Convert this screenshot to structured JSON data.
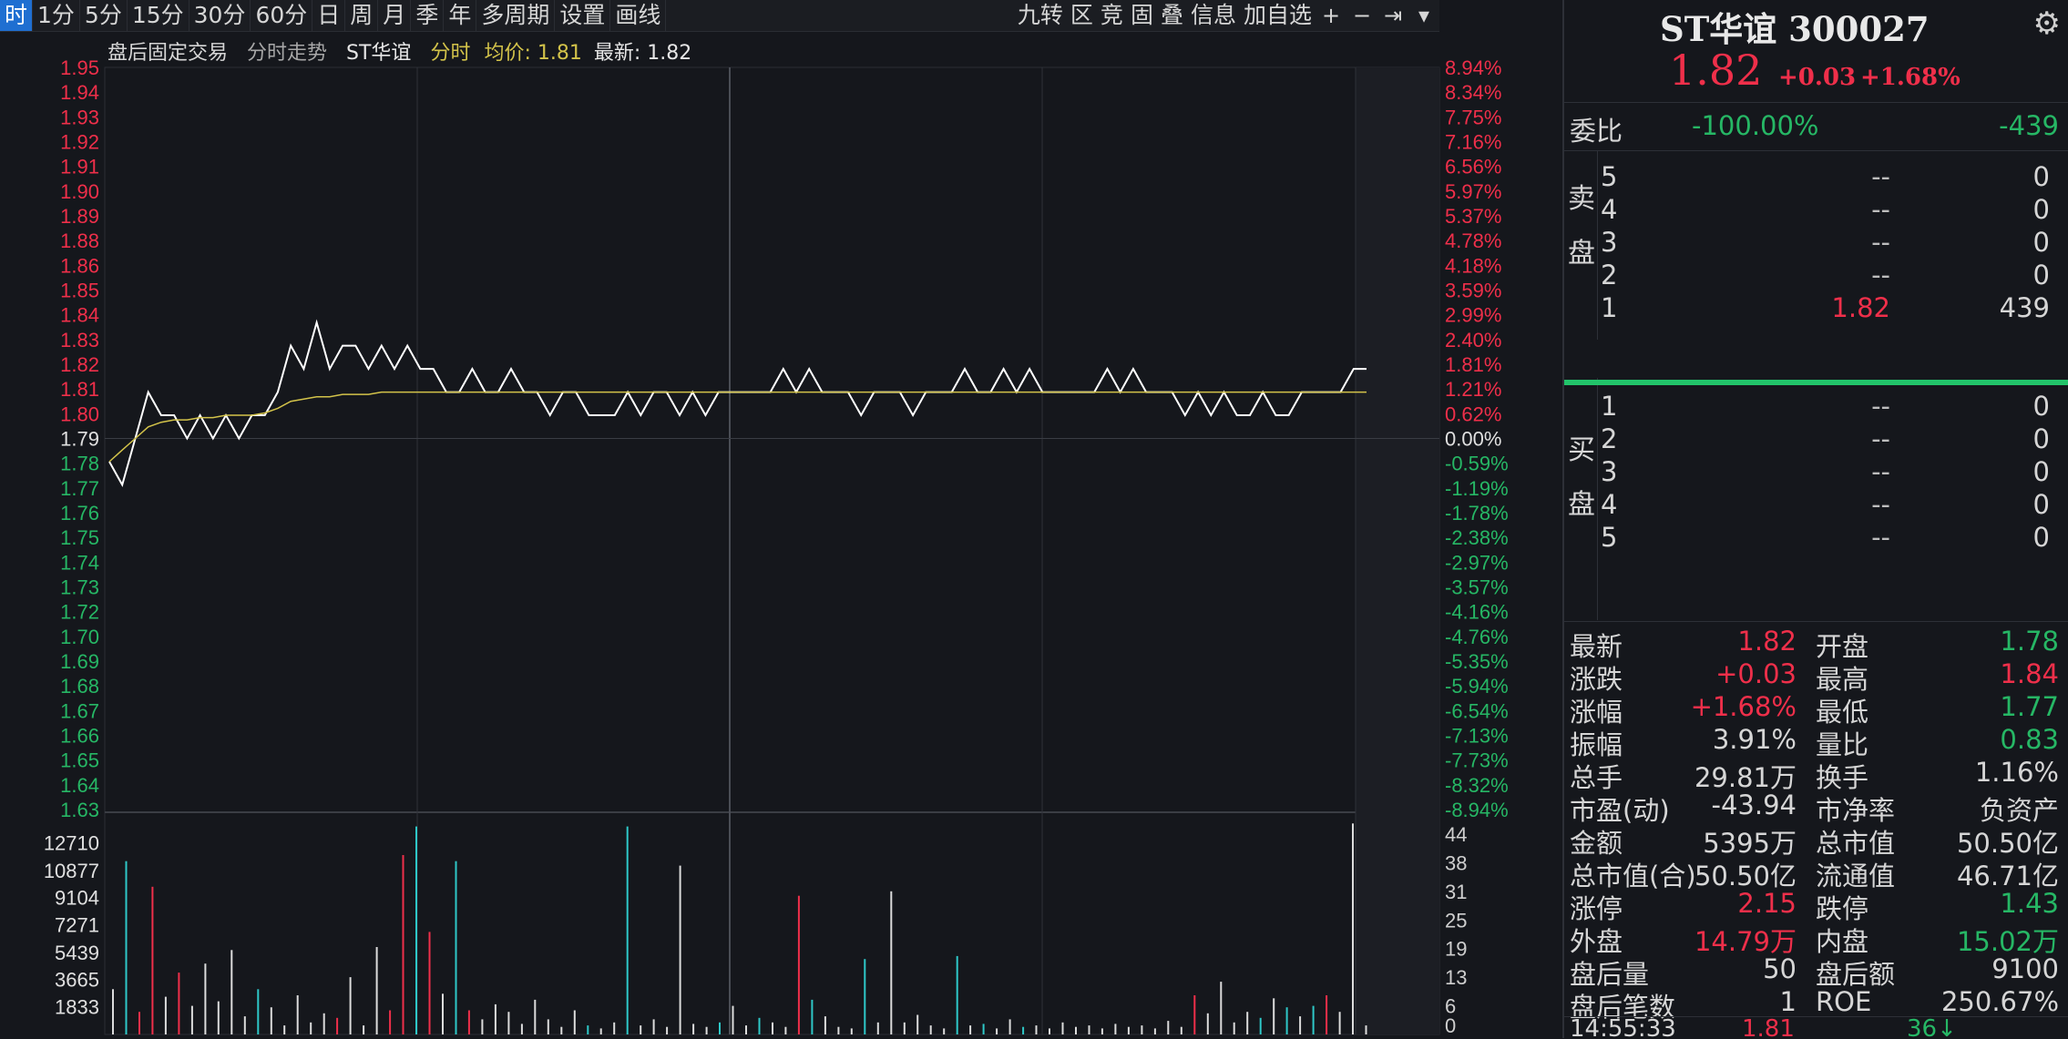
{
  "toolbar": {
    "periods": [
      "时",
      "1分",
      "5分",
      "15分",
      "30分",
      "60分",
      "日",
      "周",
      "月",
      "季",
      "年",
      "多周期",
      "设置",
      "画线"
    ],
    "active_index": 0,
    "tools": [
      "九转",
      "区",
      "竞",
      "固",
      "叠",
      "信息",
      "加自选"
    ],
    "buttons": {
      "add_icon": "+",
      "minus_icon": "−",
      "exit_icon": "⇥",
      "dropdown_icon": "▾"
    }
  },
  "chart_header": {
    "mode": "盘后固定交易",
    "view": "分时走势",
    "stock": "ST华谊",
    "series_label": "分时",
    "avg_label": "均价:",
    "avg_value": "1.81",
    "last_label": "最新:",
    "last_value": "1.82"
  },
  "chart_data": {
    "type": "line",
    "price_axis": [
      "1.95",
      "1.94",
      "1.93",
      "1.92",
      "1.91",
      "1.90",
      "1.89",
      "1.88",
      "1.86",
      "1.85",
      "1.84",
      "1.83",
      "1.82",
      "1.81",
      "1.80",
      "1.79",
      "1.78",
      "1.77",
      "1.76",
      "1.75",
      "1.74",
      "1.73",
      "1.72",
      "1.70",
      "1.69",
      "1.68",
      "1.67",
      "1.66",
      "1.65",
      "1.64",
      "1.63"
    ],
    "pct_axis": [
      "8.94%",
      "8.34%",
      "7.75%",
      "7.16%",
      "6.56%",
      "5.97%",
      "5.37%",
      "4.78%",
      "4.18%",
      "3.59%",
      "2.99%",
      "2.40%",
      "1.81%",
      "1.21%",
      "0.62%",
      "0.00%",
      "-0.59%",
      "-1.19%",
      "-1.78%",
      "-2.38%",
      "-2.97%",
      "-3.57%",
      "-4.16%",
      "-4.76%",
      "-5.35%",
      "-5.94%",
      "-6.54%",
      "-7.13%",
      "-7.73%",
      "-8.32%",
      "-8.94%"
    ],
    "prev_close": 1.79,
    "ylim": [
      1.63,
      1.95
    ],
    "price_series": [
      1.78,
      1.77,
      1.79,
      1.81,
      1.8,
      1.8,
      1.79,
      1.8,
      1.79,
      1.8,
      1.79,
      1.8,
      1.8,
      1.81,
      1.83,
      1.82,
      1.84,
      1.82,
      1.83,
      1.83,
      1.82,
      1.83,
      1.82,
      1.83,
      1.82,
      1.82,
      1.81,
      1.81,
      1.82,
      1.81,
      1.81,
      1.82,
      1.81,
      1.81,
      1.8,
      1.81,
      1.81,
      1.8,
      1.8,
      1.8,
      1.81,
      1.8,
      1.81,
      1.81,
      1.8,
      1.81,
      1.8,
      1.81,
      1.81,
      1.81,
      1.81,
      1.81,
      1.82,
      1.81,
      1.82,
      1.81,
      1.81,
      1.81,
      1.8,
      1.81,
      1.81,
      1.81,
      1.8,
      1.81,
      1.81,
      1.81,
      1.82,
      1.81,
      1.81,
      1.82,
      1.81,
      1.82,
      1.81,
      1.81,
      1.81,
      1.81,
      1.81,
      1.82,
      1.81,
      1.82,
      1.81,
      1.81,
      1.81,
      1.8,
      1.81,
      1.8,
      1.81,
      1.8,
      1.8,
      1.81,
      1.8,
      1.8,
      1.81,
      1.81,
      1.81,
      1.81,
      1.82,
      1.82
    ],
    "avg_series": [
      1.78,
      1.785,
      1.79,
      1.795,
      1.797,
      1.798,
      1.798,
      1.799,
      1.799,
      1.8,
      1.8,
      1.8,
      1.801,
      1.803,
      1.806,
      1.807,
      1.808,
      1.808,
      1.809,
      1.809,
      1.809,
      1.81,
      1.81,
      1.81,
      1.81,
      1.81,
      1.81,
      1.81,
      1.81,
      1.81,
      1.81,
      1.81,
      1.81,
      1.81,
      1.81,
      1.81,
      1.81,
      1.81,
      1.81,
      1.81,
      1.81,
      1.81,
      1.81,
      1.81,
      1.81,
      1.81,
      1.81,
      1.81,
      1.81,
      1.81,
      1.81,
      1.81,
      1.81,
      1.81,
      1.81,
      1.81,
      1.81,
      1.81,
      1.81,
      1.81,
      1.81,
      1.81,
      1.81,
      1.81,
      1.81,
      1.81,
      1.81,
      1.81,
      1.81,
      1.81,
      1.81,
      1.81,
      1.81,
      1.81,
      1.81,
      1.81,
      1.81,
      1.81,
      1.81,
      1.81,
      1.81,
      1.81,
      1.81,
      1.81,
      1.81,
      1.81,
      1.81,
      1.81,
      1.81,
      1.81,
      1.81,
      1.81,
      1.81,
      1.81,
      1.81,
      1.81,
      1.81,
      1.81
    ],
    "volume_axis": [
      "12710",
      "10877",
      "9104",
      "7271",
      "5439",
      "3665",
      "1833"
    ],
    "volume_axis_right": [
      "44",
      "38",
      "31",
      "25",
      "19",
      "13",
      "6",
      "0"
    ],
    "volume_ylim": [
      0,
      14500
    ],
    "volumes": [
      {
        "v": 3000,
        "c": "w"
      },
      {
        "v": 11500,
        "c": "c"
      },
      {
        "v": 1500,
        "c": "r"
      },
      {
        "v": 9800,
        "c": "r"
      },
      {
        "v": 2500,
        "c": "w"
      },
      {
        "v": 4100,
        "c": "r"
      },
      {
        "v": 1900,
        "c": "w"
      },
      {
        "v": 4700,
        "c": "w"
      },
      {
        "v": 2200,
        "c": "w"
      },
      {
        "v": 5600,
        "c": "w"
      },
      {
        "v": 1200,
        "c": "w"
      },
      {
        "v": 3000,
        "c": "c"
      },
      {
        "v": 1800,
        "c": "w"
      },
      {
        "v": 600,
        "c": "w"
      },
      {
        "v": 2600,
        "c": "w"
      },
      {
        "v": 800,
        "c": "w"
      },
      {
        "v": 1400,
        "c": "w"
      },
      {
        "v": 1100,
        "c": "r"
      },
      {
        "v": 3800,
        "c": "w"
      },
      {
        "v": 600,
        "c": "w"
      },
      {
        "v": 5800,
        "c": "w"
      },
      {
        "v": 1600,
        "c": "r"
      },
      {
        "v": 11900,
        "c": "r"
      },
      {
        "v": 13800,
        "c": "c"
      },
      {
        "v": 6800,
        "c": "r"
      },
      {
        "v": 2700,
        "c": "w"
      },
      {
        "v": 11500,
        "c": "c"
      },
      {
        "v": 1600,
        "c": "r"
      },
      {
        "v": 1000,
        "c": "w"
      },
      {
        "v": 2000,
        "c": "w"
      },
      {
        "v": 1500,
        "c": "w"
      },
      {
        "v": 700,
        "c": "w"
      },
      {
        "v": 2300,
        "c": "w"
      },
      {
        "v": 1000,
        "c": "w"
      },
      {
        "v": 500,
        "c": "w"
      },
      {
        "v": 1600,
        "c": "w"
      },
      {
        "v": 600,
        "c": "c"
      },
      {
        "v": 400,
        "c": "w"
      },
      {
        "v": 800,
        "c": "w"
      },
      {
        "v": 13800,
        "c": "c"
      },
      {
        "v": 600,
        "c": "w"
      },
      {
        "v": 1000,
        "c": "w"
      },
      {
        "v": 500,
        "c": "w"
      },
      {
        "v": 11200,
        "c": "w"
      },
      {
        "v": 700,
        "c": "w"
      },
      {
        "v": 500,
        "c": "w"
      },
      {
        "v": 800,
        "c": "c"
      },
      {
        "v": 1900,
        "c": "w"
      },
      {
        "v": 600,
        "c": "w"
      },
      {
        "v": 1100,
        "c": "c"
      },
      {
        "v": 800,
        "c": "w"
      },
      {
        "v": 500,
        "c": "w"
      },
      {
        "v": 9200,
        "c": "r"
      },
      {
        "v": 2300,
        "c": "c"
      },
      {
        "v": 1200,
        "c": "w"
      },
      {
        "v": 500,
        "c": "w"
      },
      {
        "v": 400,
        "c": "w"
      },
      {
        "v": 5000,
        "c": "c"
      },
      {
        "v": 800,
        "c": "w"
      },
      {
        "v": 9500,
        "c": "w"
      },
      {
        "v": 800,
        "c": "w"
      },
      {
        "v": 1300,
        "c": "w"
      },
      {
        "v": 600,
        "c": "w"
      },
      {
        "v": 400,
        "c": "w"
      },
      {
        "v": 5200,
        "c": "c"
      },
      {
        "v": 600,
        "c": "w"
      },
      {
        "v": 700,
        "c": "c"
      },
      {
        "v": 400,
        "c": "w"
      },
      {
        "v": 1000,
        "c": "w"
      },
      {
        "v": 500,
        "c": "c"
      },
      {
        "v": 600,
        "c": "w"
      },
      {
        "v": 400,
        "c": "w"
      },
      {
        "v": 800,
        "c": "w"
      },
      {
        "v": 500,
        "c": "w"
      },
      {
        "v": 600,
        "c": "w"
      },
      {
        "v": 400,
        "c": "w"
      },
      {
        "v": 700,
        "c": "w"
      },
      {
        "v": 500,
        "c": "w"
      },
      {
        "v": 600,
        "c": "w"
      },
      {
        "v": 400,
        "c": "w"
      },
      {
        "v": 900,
        "c": "w"
      },
      {
        "v": 500,
        "c": "w"
      },
      {
        "v": 2600,
        "c": "r"
      },
      {
        "v": 1400,
        "c": "w"
      },
      {
        "v": 3500,
        "c": "w"
      },
      {
        "v": 800,
        "c": "w"
      },
      {
        "v": 1500,
        "c": "w"
      },
      {
        "v": 1100,
        "c": "c"
      },
      {
        "v": 2400,
        "c": "w"
      },
      {
        "v": 1800,
        "c": "c"
      },
      {
        "v": 1200,
        "c": "w"
      },
      {
        "v": 1900,
        "c": "c"
      },
      {
        "v": 2600,
        "c": "r"
      },
      {
        "v": 1500,
        "c": "w"
      },
      {
        "v": 14000,
        "c": "w"
      },
      {
        "v": 600,
        "c": "w"
      }
    ]
  },
  "quote": {
    "title": "ST华谊 300027",
    "price": "1.82",
    "change": "+0.03",
    "change_pct": "+1.68%",
    "gear_icon": "⚙"
  },
  "weibi": {
    "label": "委比",
    "pct": "-100.00%",
    "diff": "-439"
  },
  "sell_label": [
    "卖",
    "盘"
  ],
  "buy_label": [
    "买",
    "盘"
  ],
  "asks": [
    {
      "level": "5",
      "price": "--",
      "vol": "0"
    },
    {
      "level": "4",
      "price": "--",
      "vol": "0"
    },
    {
      "level": "3",
      "price": "--",
      "vol": "0"
    },
    {
      "level": "2",
      "price": "--",
      "vol": "0"
    },
    {
      "level": "1",
      "price": "1.82",
      "vol": "439"
    }
  ],
  "bids": [
    {
      "level": "1",
      "price": "--",
      "vol": "0"
    },
    {
      "level": "2",
      "price": "--",
      "vol": "0"
    },
    {
      "level": "3",
      "price": "--",
      "vol": "0"
    },
    {
      "level": "4",
      "price": "--",
      "vol": "0"
    },
    {
      "level": "5",
      "price": "--",
      "vol": "0"
    }
  ],
  "stats": [
    {
      "k1": "最新",
      "v1": "1.82",
      "c1": "red",
      "k2": "开盘",
      "v2": "1.78",
      "c2": "green"
    },
    {
      "k1": "涨跌",
      "v1": "+0.03",
      "c1": "red",
      "k2": "最高",
      "v2": "1.84",
      "c2": "red"
    },
    {
      "k1": "涨幅",
      "v1": "+1.68%",
      "c1": "red",
      "k2": "最低",
      "v2": "1.77",
      "c2": "green"
    },
    {
      "k1": "振幅",
      "v1": "3.91%",
      "c1": "",
      "k2": "量比",
      "v2": "0.83",
      "c2": "green"
    },
    {
      "k1": "总手",
      "v1": "29.81万",
      "c1": "",
      "k2": "换手",
      "v2": "1.16%",
      "c2": ""
    },
    {
      "k1": "市盈(动)",
      "v1": "-43.94",
      "c1": "",
      "k2": "市净率",
      "v2": "负资产",
      "c2": ""
    },
    {
      "k1": "金额",
      "v1": "5395万",
      "c1": "",
      "k2": "总市值",
      "v2": "50.50亿",
      "c2": ""
    },
    {
      "k1": "总市值(合)",
      "v1": "50.50亿",
      "c1": "",
      "k2": "流通值",
      "v2": "46.71亿",
      "c2": ""
    },
    {
      "k1": "涨停",
      "v1": "2.15",
      "c1": "red",
      "k2": "跌停",
      "v2": "1.43",
      "c2": "green"
    },
    {
      "k1": "外盘",
      "v1": "14.79万",
      "c1": "red",
      "k2": "内盘",
      "v2": "15.02万",
      "c2": "green"
    },
    {
      "k1": "盘后量",
      "v1": "50",
      "c1": "",
      "k2": "盘后额",
      "v2": "9100",
      "c2": ""
    },
    {
      "k1": "盘后笔数",
      "v1": "1",
      "c1": "",
      "k2": "ROE",
      "v2": "250.67%",
      "c2": ""
    }
  ],
  "tick": {
    "time": "14:55:33",
    "price": "1.81",
    "vol": "36↓"
  },
  "colors": {
    "up": "#ef2f4a",
    "down": "#26b765",
    "accent": "#1f6fd1",
    "price_line": "#ffffff",
    "avg_line": "#d3c34a"
  }
}
